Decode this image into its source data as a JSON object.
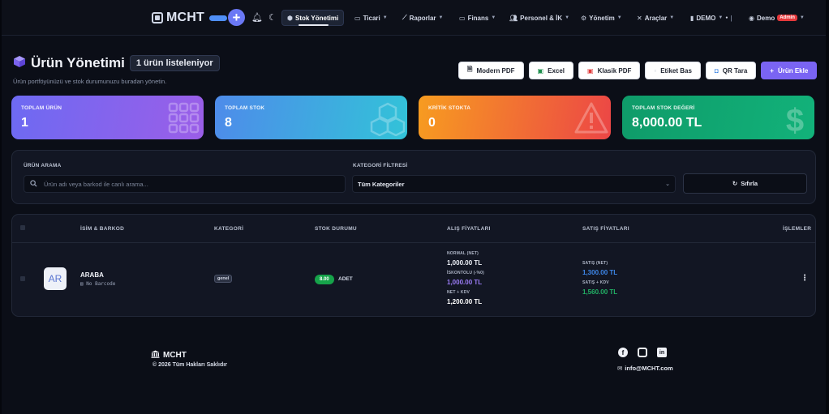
{
  "navbar": {
    "brand": "MCHT",
    "plus_label": "+",
    "items": [
      {
        "label": "Stok Yönetimi",
        "icon": "box-icon"
      },
      {
        "label": "Ticari",
        "icon": "briefcase-icon"
      },
      {
        "label": "Raporlar",
        "icon": "chart-line-icon"
      },
      {
        "label": "Finans",
        "icon": "wallet-icon"
      },
      {
        "label": "Personel & İK",
        "icon": "users-icon"
      },
      {
        "label": "Yönetim",
        "icon": "gear-icon"
      },
      {
        "label": "Araçlar",
        "icon": "tools-icon"
      },
      {
        "label": "DEMO",
        "icon": "building-icon"
      },
      {
        "label": "Demo",
        "icon": "user-circle-icon"
      }
    ],
    "admin_badge": "Admin"
  },
  "header": {
    "title": "Ürün Yönetimi",
    "count_badge": "1 ürün listeleniyor",
    "subtitle": "Ürün portföyünüzü ve stok durumunuzu buradan yönetin."
  },
  "actions": [
    {
      "label": "Modern PDF",
      "icon": "file-pdf-icon"
    },
    {
      "label": "Excel",
      "icon": "file-excel-icon"
    },
    {
      "label": "Klasik PDF",
      "icon": "file-pdf-icon"
    },
    {
      "label": "Etiket Bas",
      "icon": "tag-icon"
    },
    {
      "label": "QR Tara",
      "icon": "camera-icon"
    },
    {
      "label": "Ürün Ekle",
      "icon": "plus-icon"
    }
  ],
  "stats": [
    {
      "label": "TOPLAM ÜRÜN",
      "value": "1",
      "color": "#7c66f0"
    },
    {
      "label": "TOPLAM STOK",
      "value": "8",
      "color": "#3ba6e2"
    },
    {
      "label": "KRİTİK STOKTA",
      "value": "0",
      "color": "#f47632"
    },
    {
      "label": "TOPLAM STOK DEĞERİ",
      "value": "8,000.00 TL",
      "color": "#10a571"
    }
  ],
  "filters": {
    "search_label": "ÜRÜN ARAMA",
    "search_placeholder": "Ürün adı veya barkod ile canlı arama...",
    "category_label": "KATEGORİ FİLTRESİ",
    "category_value": "Tüm Kategoriler",
    "reset_label": "Sıfırla"
  },
  "table": {
    "headers": [
      "İSİM & BARKOD",
      "KATEGORİ",
      "STOK DURUMU",
      "ALIŞ FİYATLARI",
      "SATIŞ FİYATLARI",
      "İŞLEMLER"
    ],
    "rows": [
      {
        "avatar": "AR",
        "name": "ARABA",
        "barcode": "No Barcode",
        "category": "genel",
        "stock": "8.00",
        "unit": "ADET",
        "purchase": {
          "normal_label": "NORMAL (NET)",
          "normal_value": "1,000.00 TL",
          "discount_label": "İSKONTOLU (-%0)",
          "discount_value": "1,000.00 TL",
          "vat_label": "NET + KDV",
          "vat_value": "1,200.00 TL"
        },
        "sale": {
          "net_label": "SATIŞ (NET)",
          "net_value": "1,300.00 TL",
          "vat_label": "SATIŞ + KDV",
          "vat_value": "1,560.00 TL"
        }
      }
    ]
  },
  "footer": {
    "brand": "MCHT",
    "copyright": "© 2026 Tüm Hakları Saklıdır",
    "email": "info@MCHT.com"
  }
}
